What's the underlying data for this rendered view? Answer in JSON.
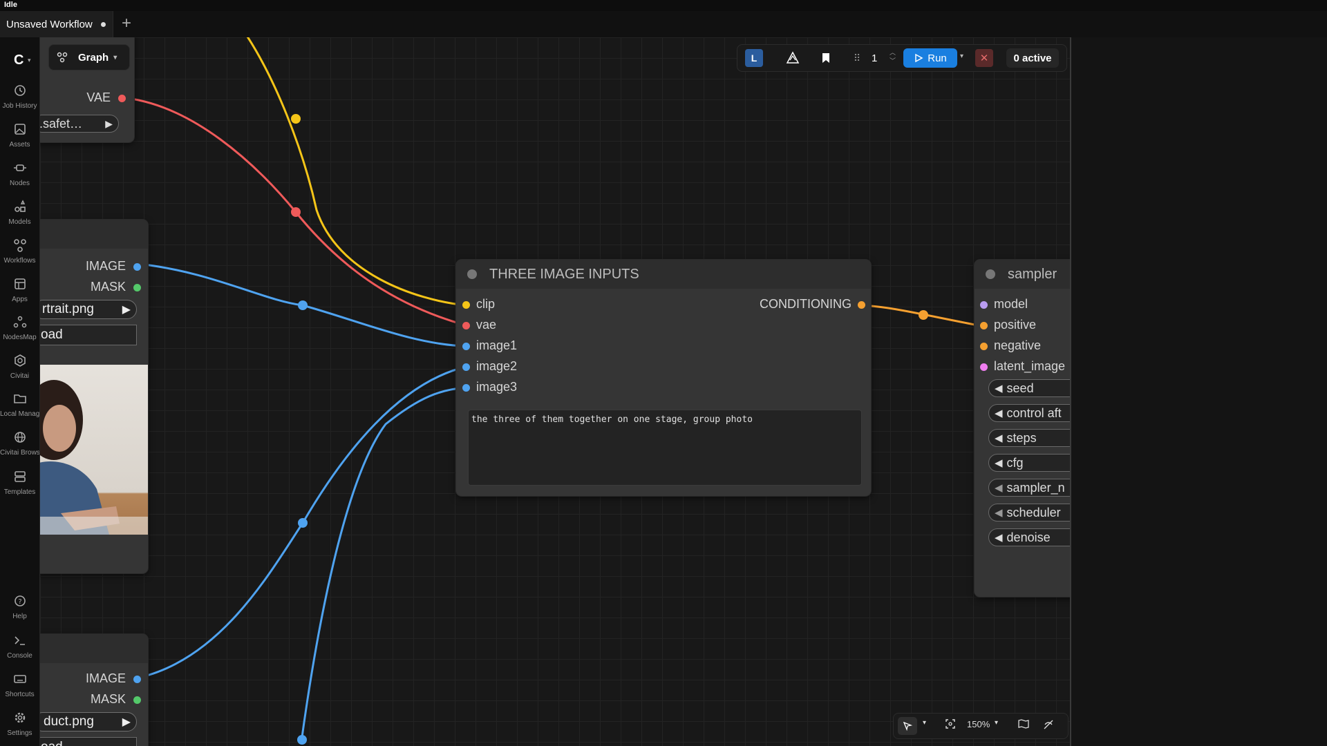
{
  "app": {
    "status": "Idle",
    "tab_title": "Unsaved Workflow",
    "new_tab_label": "+"
  },
  "sidebar": {
    "items": [
      {
        "label": "Job History",
        "icon": "history-icon"
      },
      {
        "label": "Assets",
        "icon": "image-icon"
      },
      {
        "label": "Nodes",
        "icon": "node-icon"
      },
      {
        "label": "Models",
        "icon": "models-icon"
      },
      {
        "label": "Workflows",
        "icon": "workflow-icon"
      },
      {
        "label": "Apps",
        "icon": "apps-icon"
      },
      {
        "label": "NodesMap",
        "icon": "nodesmap-icon"
      },
      {
        "label": "Civitai",
        "icon": "civitai-icon"
      },
      {
        "label": "Local Manager",
        "icon": "folder-icon"
      },
      {
        "label": "Civitai Browser",
        "icon": "globe-icon"
      },
      {
        "label": "Templates",
        "icon": "templates-icon"
      }
    ],
    "bottom_items": [
      {
        "label": "Help",
        "icon": "help-icon"
      },
      {
        "label": "Console",
        "icon": "console-icon"
      },
      {
        "label": "Shortcuts",
        "icon": "keyboard-icon"
      },
      {
        "label": "Settings",
        "icon": "settings-icon"
      }
    ]
  },
  "graph_menu": {
    "label": "Graph"
  },
  "toolbar": {
    "l_badge": "L",
    "batch_count": "1",
    "run_label": "Run",
    "active_label": "0 active",
    "accent": "#1a7fe0"
  },
  "nodes": {
    "checkpoint": {
      "output_vae": "VAE",
      "ckpt_value": ".safet…"
    },
    "load_image_1": {
      "output_image": "IMAGE",
      "output_mask": "MASK",
      "file_value": "rtrait.png",
      "upload_label": "oad"
    },
    "load_image_2": {
      "output_image": "IMAGE",
      "output_mask": "MASK",
      "file_value": "duct.png",
      "upload_label": "oad"
    },
    "three_inputs": {
      "title": "THREE IMAGE INPUTS",
      "inputs": [
        "clip",
        "vae",
        "image1",
        "image2",
        "image3"
      ],
      "output": "CONDITIONING",
      "prompt": "the three of them together on one stage, group photo"
    },
    "sampler": {
      "title": "sampler",
      "inputs": [
        "model",
        "positive",
        "negative",
        "latent_image"
      ],
      "widgets": [
        "seed",
        "control aft",
        "steps",
        "cfg",
        "sampler_n",
        "scheduler",
        "denoise"
      ]
    }
  },
  "zoom": {
    "level": "150%"
  },
  "colors": {
    "clip": "#f5c518",
    "vae": "#ef5a5a",
    "image": "#4fa3f0",
    "mask": "#54c96a",
    "conditioning": "#f5a030",
    "model": "#b99cf0",
    "latent": "#f07ef0"
  }
}
